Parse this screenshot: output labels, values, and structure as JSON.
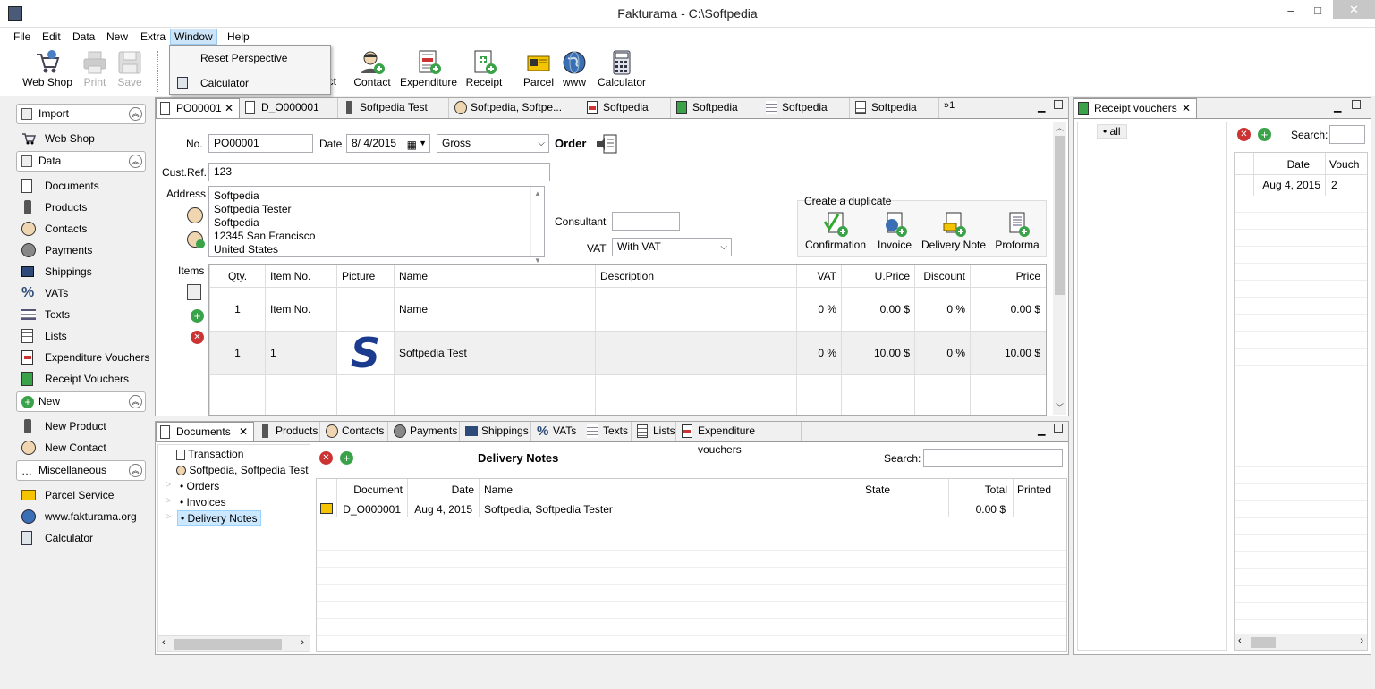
{
  "window": {
    "title": "Fakturama - C:\\Softpedia",
    "min": "–",
    "max": "□",
    "close": "✕"
  },
  "menu": [
    "File",
    "Edit",
    "Data",
    "New",
    "Extra",
    "Window",
    "Help"
  ],
  "window_menu": {
    "items": [
      "Reset Perspective",
      "Calculator"
    ]
  },
  "toolbar": {
    "webshop": "Web Shop",
    "print": "Print",
    "save": "Save",
    "product_partial": "uct",
    "contact": "Contact",
    "expenditure": "Expenditure",
    "receipt": "Receipt",
    "parcel": "Parcel",
    "www": "www",
    "calculator": "Calculator"
  },
  "sidebar": {
    "import": "Import",
    "webshop": "Web Shop",
    "data": "Data",
    "data_items": [
      "Documents",
      "Products",
      "Contacts",
      "Payments",
      "Shippings",
      "VATs",
      "Texts",
      "Lists",
      "Expenditure Vouchers",
      "Receipt Vouchers"
    ],
    "new": "New",
    "new_items": [
      "New Product",
      "New Contact"
    ],
    "misc": "Miscellaneous",
    "misc_items": [
      "Parcel Service",
      "www.fakturama.org",
      "Calculator"
    ]
  },
  "editor_tabs": [
    "PO00001",
    "D_O000001",
    "Softpedia Test",
    "Softpedia, Softpe...",
    "Softpedia",
    "Softpedia",
    "Softpedia",
    "Softpedia"
  ],
  "editor_tabs_more": "»1",
  "doc": {
    "no_label": "No.",
    "no": "PO00001",
    "date_label": "Date",
    "date": "8/  4/2015",
    "price_mode": "Gross",
    "doc_type": "Order",
    "custref_label": "Cust.Ref.",
    "custref": "123",
    "address_label": "Address",
    "address": [
      "Softpedia",
      "Softpedia Tester",
      "Softpedia",
      "12345 San Francisco",
      "United States"
    ],
    "consultant_label": "Consultant",
    "consultant": "",
    "vat_label": "VAT",
    "vat": "With VAT",
    "duplicate_label": "Create a duplicate",
    "duplicates": [
      "Confirmation",
      "Invoice",
      "Delivery Note",
      "Proforma"
    ],
    "items_label": "Items",
    "items_headers": [
      "Qty.",
      "Item No.",
      "Picture",
      "Name",
      "Description",
      "VAT",
      "U.Price",
      "Discount",
      "Price"
    ],
    "items": [
      {
        "qty": "1",
        "itemno": "Item No.",
        "name": "Name",
        "desc": "",
        "vat": "0 %",
        "uprice": "0.00 $",
        "discount": "0 %",
        "price": "0.00 $"
      },
      {
        "qty": "1",
        "itemno": "1",
        "name": "Softpedia Test",
        "desc": "",
        "vat": "0 %",
        "uprice": "10.00 $",
        "discount": "0 %",
        "price": "10.00 $"
      }
    ],
    "picture_glyph": "S"
  },
  "receipt_panel": {
    "tab": "Receipt vouchers",
    "tree": [
      "all"
    ],
    "search_label": "Search:",
    "headers": [
      "Date",
      "Vouch"
    ],
    "row": {
      "date": "Aug 4, 2015",
      "voucher": "2"
    }
  },
  "bottom_tabs": [
    "Documents",
    "Products",
    "Contacts",
    "Payments",
    "Shippings",
    "VATs",
    "Texts",
    "Lists",
    "Expenditure vouchers"
  ],
  "doc_tree": [
    "Transaction",
    "Softpedia, Softpedia Test",
    "Orders",
    "Invoices",
    "Delivery Notes"
  ],
  "list": {
    "title": "Delivery Notes",
    "search_label": "Search:",
    "headers": [
      "Document",
      "Date",
      "Name",
      "State",
      "Total",
      "Printed"
    ],
    "row": {
      "document": "D_O000001",
      "date": "Aug 4, 2015",
      "name": "Softpedia, Softpedia Tester",
      "state": "",
      "total": "0.00 $",
      "printed": ""
    }
  },
  "colors": {
    "accent": "#cce4f7",
    "selection": "#cce8ff",
    "add_green": "#3aa34a",
    "delete_red": "#cc3333"
  }
}
